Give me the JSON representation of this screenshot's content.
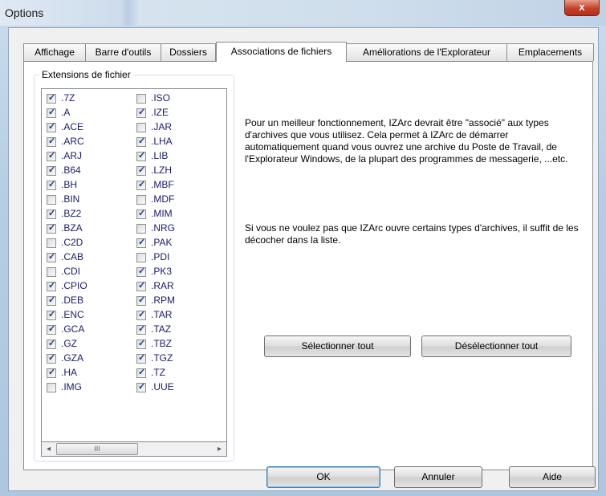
{
  "window": {
    "title": "Options",
    "close_label": "x"
  },
  "tabs": [
    "Affichage",
    "Barre d'outils",
    "Dossiers",
    "Associations de fichiers",
    "Améliorations de l'Explorateur",
    "Emplacements"
  ],
  "active_tab": "Associations de fichiers",
  "extensions": {
    "group_label": "Extensions de fichier",
    "column1": [
      {
        "label": ".7Z",
        "checked": true
      },
      {
        "label": ".A",
        "checked": true
      },
      {
        "label": ".ACE",
        "checked": true
      },
      {
        "label": ".ARC",
        "checked": true
      },
      {
        "label": ".ARJ",
        "checked": true
      },
      {
        "label": ".B64",
        "checked": true
      },
      {
        "label": ".BH",
        "checked": true
      },
      {
        "label": ".BIN",
        "checked": false
      },
      {
        "label": ".BZ2",
        "checked": true
      },
      {
        "label": ".BZA",
        "checked": true
      },
      {
        "label": ".C2D",
        "checked": false
      },
      {
        "label": ".CAB",
        "checked": true
      },
      {
        "label": ".CDI",
        "checked": false
      },
      {
        "label": ".CPIO",
        "checked": true
      },
      {
        "label": ".DEB",
        "checked": true
      },
      {
        "label": ".ENC",
        "checked": true
      },
      {
        "label": ".GCA",
        "checked": true
      },
      {
        "label": ".GZ",
        "checked": true
      },
      {
        "label": ".GZA",
        "checked": true
      },
      {
        "label": ".HA",
        "checked": true
      },
      {
        "label": ".IMG",
        "checked": false
      }
    ],
    "column2": [
      {
        "label": ".ISO",
        "checked": false
      },
      {
        "label": ".IZE",
        "checked": true
      },
      {
        "label": ".JAR",
        "checked": false
      },
      {
        "label": ".LHA",
        "checked": true
      },
      {
        "label": ".LIB",
        "checked": true
      },
      {
        "label": ".LZH",
        "checked": true
      },
      {
        "label": ".MBF",
        "checked": true
      },
      {
        "label": ".MDF",
        "checked": false
      },
      {
        "label": ".MIM",
        "checked": true
      },
      {
        "label": ".NRG",
        "checked": false
      },
      {
        "label": ".PAK",
        "checked": true
      },
      {
        "label": ".PDI",
        "checked": false
      },
      {
        "label": ".PK3",
        "checked": true
      },
      {
        "label": ".RAR",
        "checked": true
      },
      {
        "label": ".RPM",
        "checked": true
      },
      {
        "label": ".TAR",
        "checked": true
      },
      {
        "label": ".TAZ",
        "checked": true
      },
      {
        "label": ".TBZ",
        "checked": true
      },
      {
        "label": ".TGZ",
        "checked": true
      },
      {
        "label": ".TZ",
        "checked": true
      },
      {
        "label": ".UUE",
        "checked": true
      }
    ],
    "scroll": {
      "left_arrow": "◂",
      "right_arrow": "▸",
      "thumb_grip": "III"
    }
  },
  "info": {
    "paragraph1": "Pour un meilleur fonctionnement, IZArc devrait être \"associé\" aux types d'archives que vous utilisez. Cela permet à IZArc de démarrer automatiquement quand vous ouvrez une archive du Poste de Travail, de l'Explorateur Windows, de la plupart des programmes de messagerie, ...etc.",
    "paragraph2": "Si vous ne voulez pas que IZArc ouvre certains types d'archives, il suffit de les décocher dans la liste."
  },
  "buttons": {
    "select_all": "Sélectionner tout",
    "deselect_all": "Désélectionner tout",
    "ok": "OK",
    "cancel": "Annuler",
    "help": "Aide"
  }
}
